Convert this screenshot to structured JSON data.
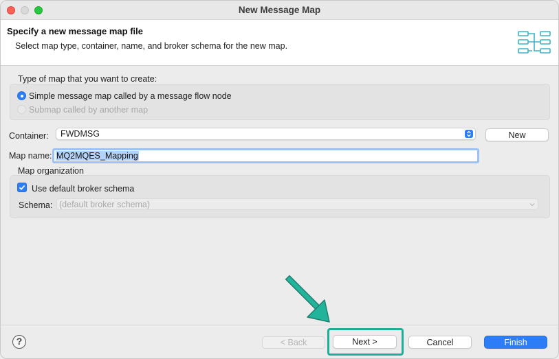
{
  "window": {
    "title": "New Message Map"
  },
  "header": {
    "title": "Specify a new message map file",
    "description": "Select map type, container, name, and broker schema for the new map.",
    "icon": "map-diagram-icon"
  },
  "map_type": {
    "label": "Type of map that you want to create:",
    "options": [
      {
        "label": "Simple message map called by a message flow node",
        "selected": true,
        "enabled": true
      },
      {
        "label": "Submap called by another map",
        "selected": false,
        "enabled": false
      }
    ]
  },
  "container": {
    "label": "Container:",
    "value": "FWDMSG",
    "new_button": "New"
  },
  "map_name": {
    "label": "Map name:",
    "value": "MQ2MQES_Mapping"
  },
  "organization": {
    "label": "Map organization",
    "use_default_label": "Use default broker schema",
    "use_default_checked": true,
    "schema_label": "Schema:",
    "schema_placeholder": "(default broker schema)"
  },
  "footer": {
    "help": "?",
    "back": "< Back",
    "next": "Next >",
    "cancel": "Cancel",
    "finish": "Finish"
  },
  "colors": {
    "accent": "#2d7df6",
    "highlight": "#1dae97"
  }
}
